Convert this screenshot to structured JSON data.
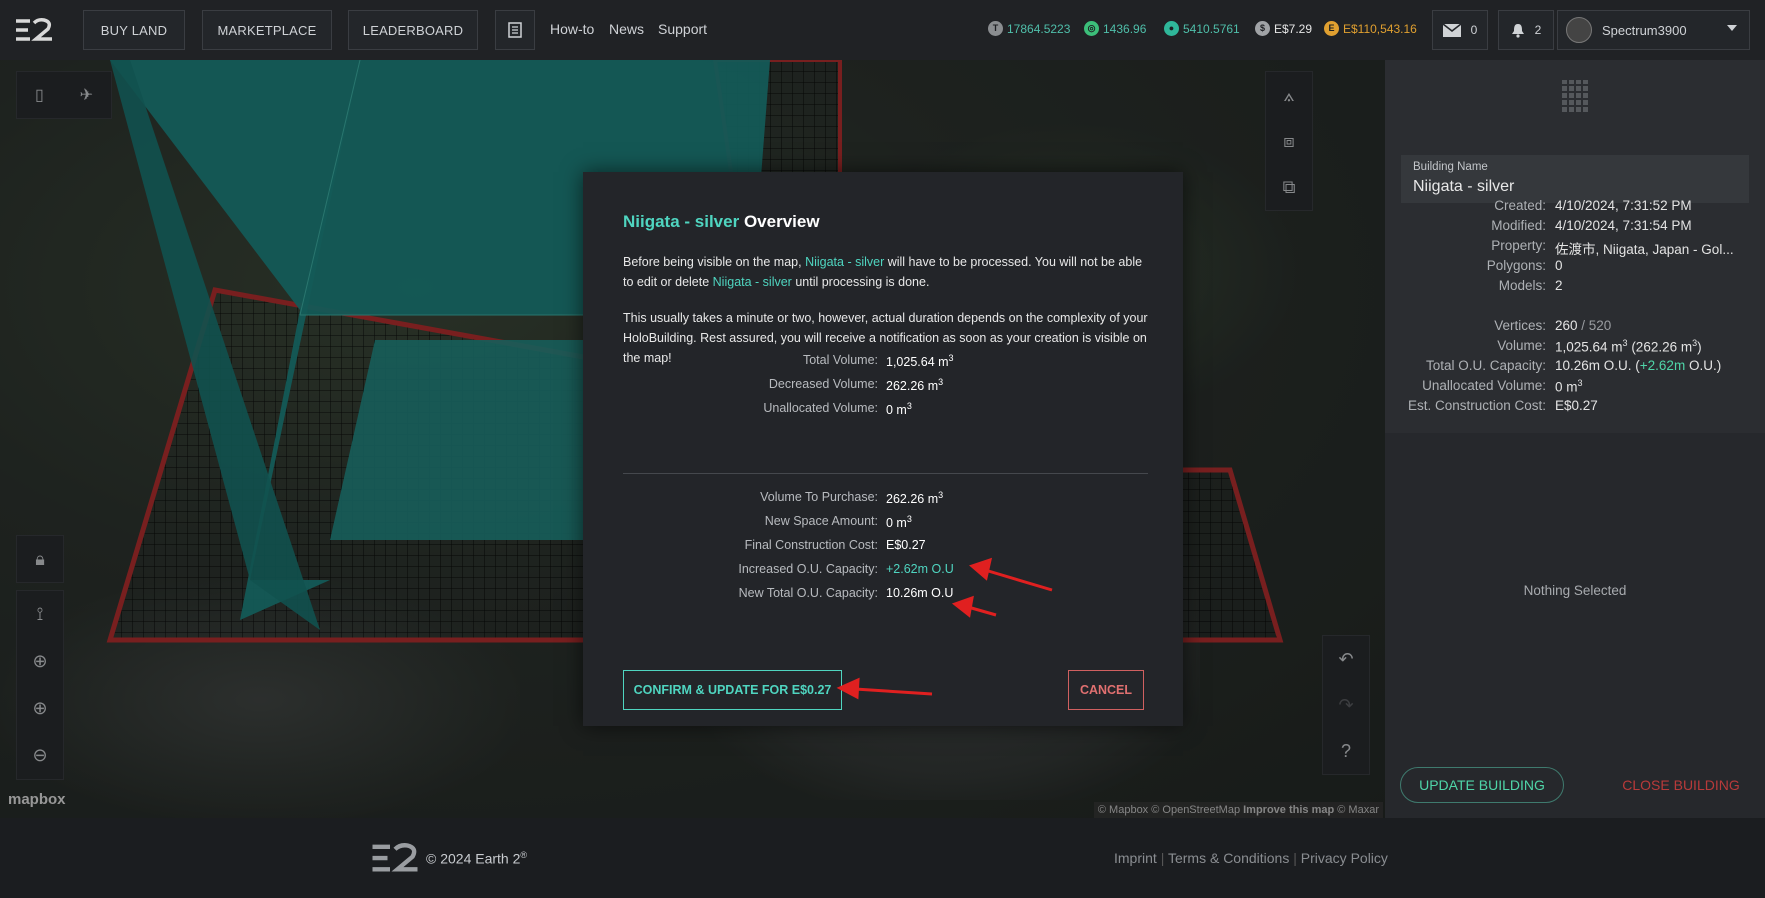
{
  "nav": {
    "buy_land": "BUY LAND",
    "marketplace": "MARKETPLACE",
    "leaderboard": "LEADERBOARD",
    "howto": "How-to",
    "news": "News",
    "support": "Support"
  },
  "stats": {
    "tokens1": "17864.5223",
    "tokens2": "1436.96",
    "tokens3": "5410.5761",
    "balance": "E$7.29",
    "total": "E$110,543.16",
    "mail_count": "0",
    "notif_count": "2",
    "username": "Spectrum3900"
  },
  "map": {
    "attribution_logo": "mapbox",
    "attribution": "© Mapbox © OpenStreetMap",
    "improve": "Improve this map",
    "maxar": "© Maxar"
  },
  "dialog": {
    "title_name": "Niigata - silver",
    "title_suffix": " Overview",
    "p1_a": "Before being visible on the map, ",
    "p1_name": "Niigata - silver",
    "p1_b": " will have to be processed. You will not be able to edit or delete ",
    "p1_name2": "Niigata - silver",
    "p1_c": " until processing is done.",
    "p2": "This usually takes a minute or two, however, actual duration depends on the complexity of your HoloBuilding. Rest assured, you will receive a notification as soon as your creation is visible on the map!",
    "rows1": [
      {
        "label": "Total Volume:",
        "value": "1,025.64 m",
        "sup": "3"
      },
      {
        "label": "Decreased Volume:",
        "value": "262.26 m",
        "sup": "3"
      },
      {
        "label": "Unallocated Volume:",
        "value": "0 m",
        "sup": "3"
      }
    ],
    "rows2": [
      {
        "label": "Volume To Purchase:",
        "value": "262.26 m",
        "sup": "3"
      },
      {
        "label": "New Space Amount:",
        "value": "0 m",
        "sup": "3"
      },
      {
        "label": "Final Construction Cost:",
        "value": "E$0.27",
        "sup": ""
      },
      {
        "label": "Increased O.U. Capacity:",
        "value": "+2.62m O.U",
        "sup": ""
      },
      {
        "label": "New Total O.U. Capacity:",
        "value": "10.26m O.U",
        "sup": ""
      }
    ],
    "confirm": "CONFIRM & UPDATE FOR E$0.27",
    "cancel": "CANCEL"
  },
  "panel": {
    "bname_label": "Building Name",
    "bname_value": "Niigata - silver",
    "props": [
      {
        "label": "Created:",
        "value": "4/10/2024, 7:31:52 PM"
      },
      {
        "label": "Modified:",
        "value": "4/10/2024, 7:31:54 PM"
      },
      {
        "label": "Property:",
        "value": "佐渡市, Niigata, Japan - Gol..."
      },
      {
        "label": "Polygons:",
        "value": "0"
      },
      {
        "label": "Models:",
        "value": "2"
      }
    ],
    "vertices_label": "Vertices:",
    "vertices_a": "260",
    "vertices_b": " / 520",
    "volume_label": "Volume:",
    "volume_a": "1,025.64 m",
    "volume_sup": "3",
    "volume_b": " (262.26 m",
    "volume_sup2": "3",
    "volume_c": ")",
    "ou_label": "Total O.U. Capacity:",
    "ou_a": "10.26m O.U. (",
    "ou_b": "+2.62m",
    "ou_c": " O.U.)",
    "unalloc_label": "Unallocated Volume:",
    "unalloc_value": "0 m",
    "unalloc_sup": "3",
    "cost_label": "Est. Construction Cost:",
    "cost_value": "E$0.27",
    "nothing": "Nothing Selected",
    "update": "UPDATE BUILDING",
    "close": "CLOSE BUILDING"
  },
  "footer": {
    "copyright": "© 2024 Earth 2",
    "reg": "®",
    "imprint": "Imprint",
    "terms": "Terms & Conditions",
    "privacy": "Privacy Policy"
  },
  "colors": {
    "accent": "#4fd5c0",
    "cancel": "#e07070",
    "arrow": "#e02020",
    "building": "#1f8a86"
  }
}
